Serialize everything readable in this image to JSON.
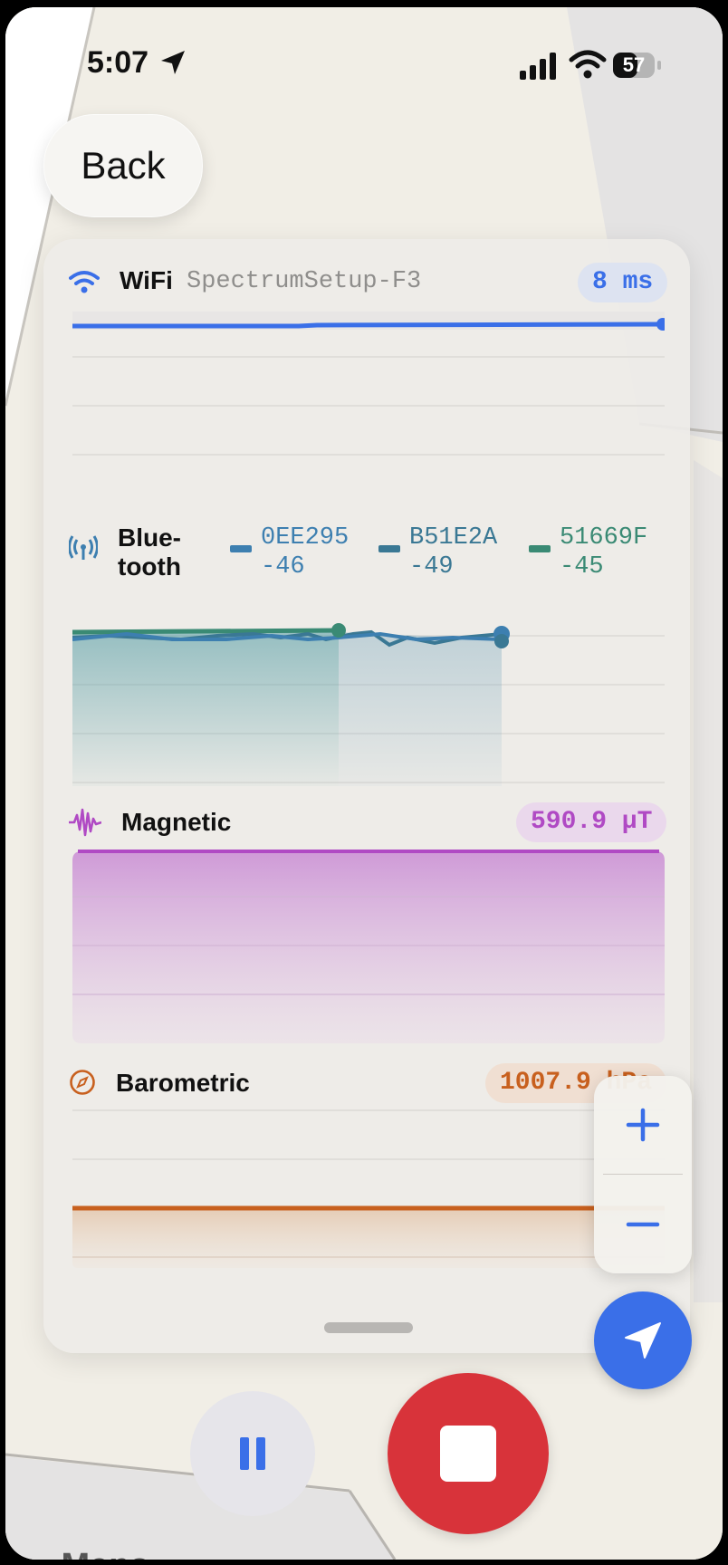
{
  "status_bar": {
    "time": "5:07",
    "battery": "57"
  },
  "back_label": "Back",
  "wifi": {
    "label": "WiFi",
    "network": "SpectrumSetup-F3",
    "value": "8 ms",
    "color": "#3a6fe8"
  },
  "bluetooth": {
    "label_line1": "Blue-",
    "label_line2": "tooth",
    "devices": [
      {
        "id": "0EE295",
        "rssi": "-46",
        "color": "#3d7fb0"
      },
      {
        "id": "B51E2A",
        "rssi": "-49",
        "color": "#3a7894"
      },
      {
        "id": "51669F",
        "rssi": "-45",
        "color": "#3a8a74"
      }
    ]
  },
  "magnetic": {
    "label": "Magnetic",
    "value": "590.9 µT",
    "color": "#b04ac4"
  },
  "barometric": {
    "label": "Barometric",
    "value": "1007.9 hPa",
    "color": "#c8601e"
  },
  "map_attribution": "Maps"
}
